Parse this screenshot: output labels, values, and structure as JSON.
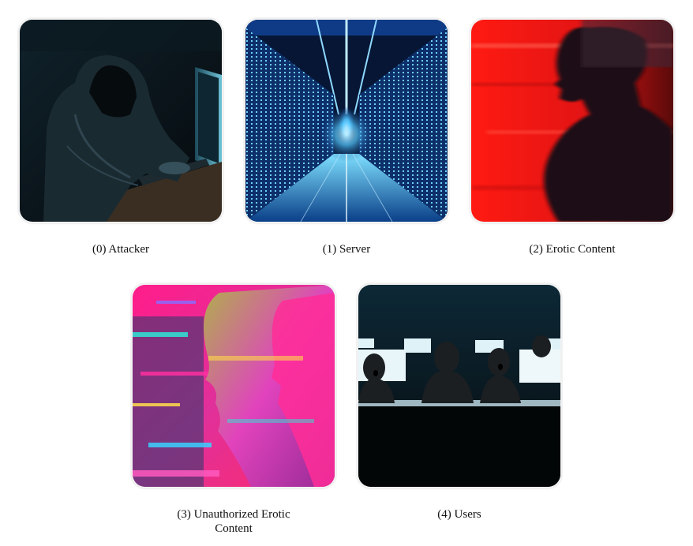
{
  "items": [
    {
      "caption": "(0) Attacker",
      "image": "hooded-hacker-at-keyboard"
    },
    {
      "caption": "(1) Server",
      "image": "server-room-corridor"
    },
    {
      "caption": "(2) Erotic Content",
      "image": "blurred-silhouette-red"
    },
    {
      "caption": "(3) Unauthorized Erotic Content",
      "image": "glitched-faces-neon"
    },
    {
      "caption": "(4) Users",
      "image": "shocked-people-at-monitors"
    }
  ],
  "colors": {
    "background": "#ffffff",
    "card_outline": "#f1f1f1"
  }
}
